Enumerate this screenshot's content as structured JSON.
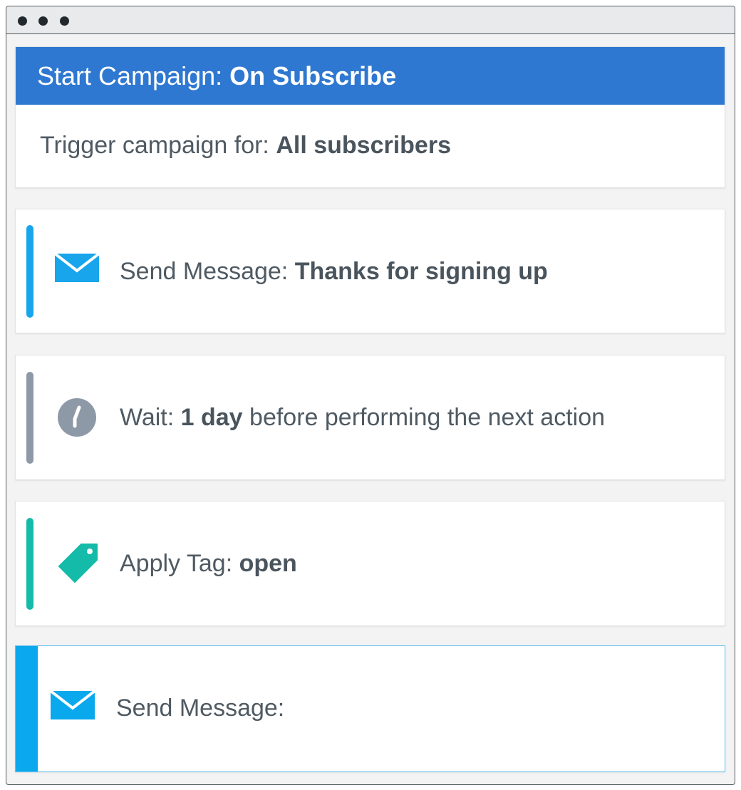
{
  "campaign": {
    "header_label": "Start Campaign:",
    "header_value": "On Subscribe",
    "trigger_label": "Trigger campaign for:",
    "trigger_value": "All subscribers"
  },
  "steps": [
    {
      "icon": "envelope-icon",
      "label": "Send Message:",
      "value": "Thanks for signing up",
      "suffix": "",
      "accent_color": "#18a5ec"
    },
    {
      "icon": "clock-icon",
      "label": "Wait:",
      "value": "1 day",
      "suffix": "before performing the next action",
      "accent_color": "#8d99a6"
    },
    {
      "icon": "tag-icon",
      "label": "Apply Tag:",
      "value": "open",
      "suffix": "",
      "accent_color": "#13bba8"
    },
    {
      "icon": "envelope-icon",
      "label": "Send Message:",
      "value": "",
      "suffix": "",
      "accent_color": "#0aa8ed",
      "selected": true
    }
  ],
  "colors": {
    "header_bg": "#2f78d1",
    "text": "#4f5a63",
    "window_bg": "#f3f3f3"
  }
}
